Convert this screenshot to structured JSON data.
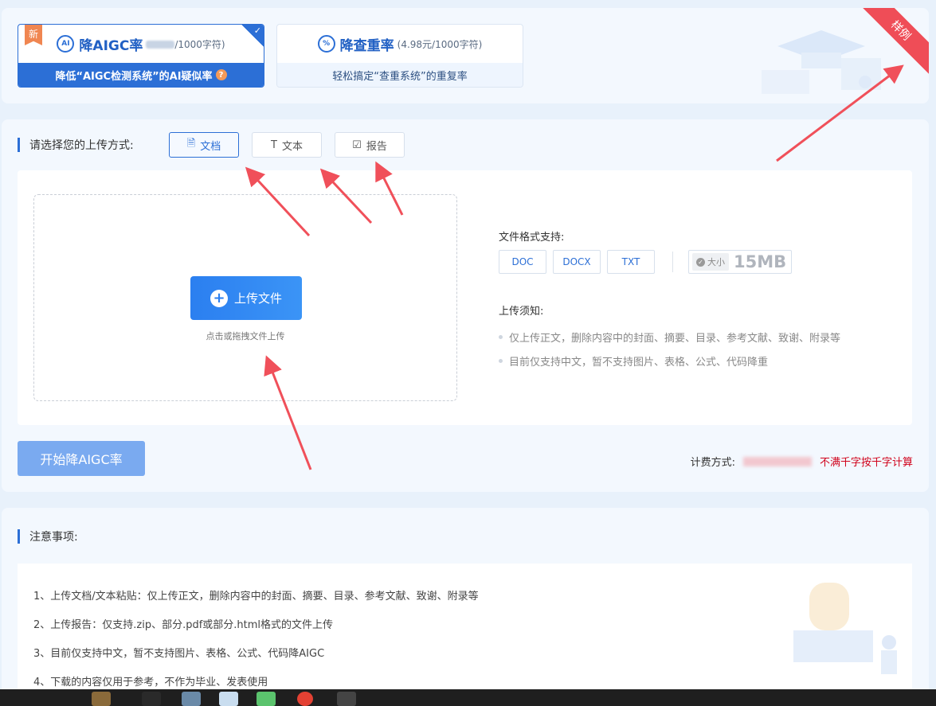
{
  "mode_tabs": {
    "aigc": {
      "badge": "新",
      "icon_text": "AI",
      "title": "降AIGC率",
      "price": "/1000字符)",
      "subtitle": "降低“AIGC检测系统”的AI疑似率",
      "check": "✓",
      "help": "?"
    },
    "dup": {
      "icon_text": "%",
      "title": "降查重率",
      "price": "(4.98元/1000字符)",
      "subtitle": "轻松搞定“查重系统”的重复率"
    },
    "sample_ribbon": "样例"
  },
  "upload": {
    "prompt": "请选择您的上传方式:",
    "methods": [
      {
        "label": "文档",
        "icon": "file-icon",
        "glyph": "🗎"
      },
      {
        "label": "文本",
        "icon": "text-icon",
        "glyph": "T"
      },
      {
        "label": "报告",
        "icon": "clipboard-icon",
        "glyph": "☑"
      }
    ],
    "upload_button": "上传文件",
    "plus": "+",
    "drop_hint": "点击或拖拽文件上传",
    "formats_title": "文件格式支持:",
    "formats": [
      "DOC",
      "DOCX",
      "TXT"
    ],
    "size_label": "大小",
    "size_check": "✓",
    "size_value": "15MB",
    "notice_title": "上传须知:",
    "notices": [
      "仅上传正文，删除内容中的封面、摘要、目录、参考文献、致谢、附录等",
      "目前仅支持中文，暂不支持图片、表格、公式、代码降重"
    ],
    "start_button": "开始降AIGC率",
    "billing_label": "计费方式:",
    "billing_note": "不满千字按千字计算"
  },
  "notes": {
    "title": "注意事项:",
    "lines": [
      "1、上传文档/文本粘贴：仅上传正文，删除内容中的封面、摘要、目录、参考文献、致谢、附录等",
      "2、上传报告：仅支持.zip、部分.pdf或部分.html格式的文件上传",
      "3、目前仅支持中文，暂不支持图片、表格、公式、代码降AIGC",
      "4、下载的内容仅用于参考，不作为毕业、发表使用"
    ]
  },
  "colors": {
    "primary": "#2c6fd6",
    "arrow": "#f0505a",
    "billing_red": "#d0021b"
  }
}
